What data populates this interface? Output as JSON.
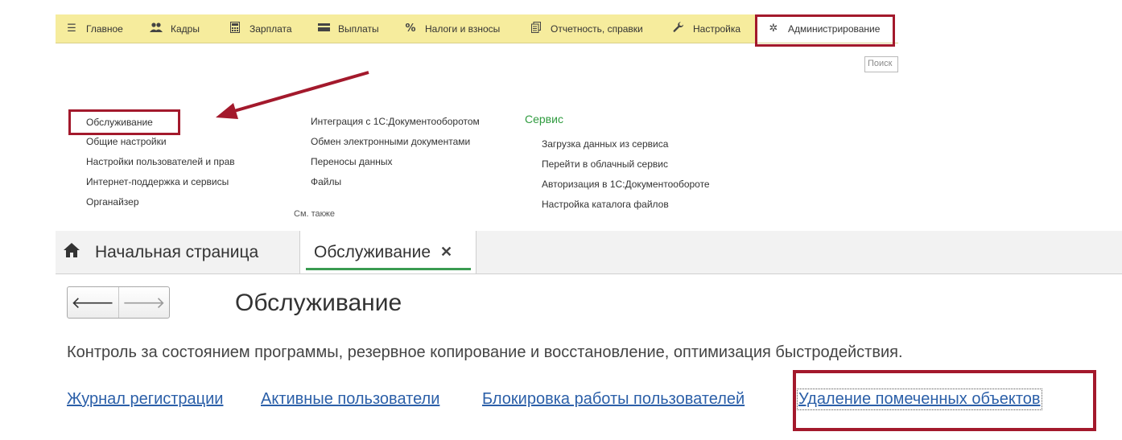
{
  "menu": {
    "items": [
      {
        "label": "Главное",
        "icon": "hamburger-menu-icon"
      },
      {
        "label": "Кадры",
        "icon": "people-icon"
      },
      {
        "label": "Зарплата",
        "icon": "calculator-icon"
      },
      {
        "label": "Выплаты",
        "icon": "wallet-icon"
      },
      {
        "label": "Налоги и взносы",
        "icon": "percent-icon"
      },
      {
        "label": "Отчетность, справки",
        "icon": "documents-icon"
      },
      {
        "label": "Настройка",
        "icon": "wrench-icon"
      },
      {
        "label": "Администрирование",
        "icon": "gear-icon",
        "active": true
      }
    ]
  },
  "search": {
    "placeholder": "Поиск"
  },
  "admin_panel": {
    "col1": [
      "Обслуживание",
      "Общие настройки",
      "Настройки пользователей и прав",
      "Интернет-поддержка и сервисы",
      "Органайзер"
    ],
    "col2": [
      "Интеграция с 1С:Документооборотом",
      "Обмен электронными документами",
      "Переносы данных",
      "Файлы"
    ],
    "see_also": "См. также",
    "service_group": {
      "title": "Сервис",
      "items": [
        "Загрузка данных из сервиса",
        "Перейти в облачный сервис",
        "Авторизация в 1С:Документообороте",
        "Настройка каталога файлов"
      ]
    }
  },
  "tabs": {
    "home_label": "Начальная страница",
    "active_label": "Обслуживание",
    "close_glyph": "✕"
  },
  "page": {
    "title": "Обслуживание",
    "description": "Контроль за состоянием программы, резервное копирование и восстановление, оптимизация быстродействия.",
    "links": [
      "Журнал регистрации",
      "Активные пользователи",
      "Блокировка работы пользователей",
      "Удаление помеченных объектов"
    ]
  },
  "colors": {
    "menu_bg": "#f6ec9d",
    "highlight": "#a3192c",
    "link": "#2b5fa8",
    "accent_green": "#3a9b51",
    "service_green": "#2f9b3f"
  }
}
